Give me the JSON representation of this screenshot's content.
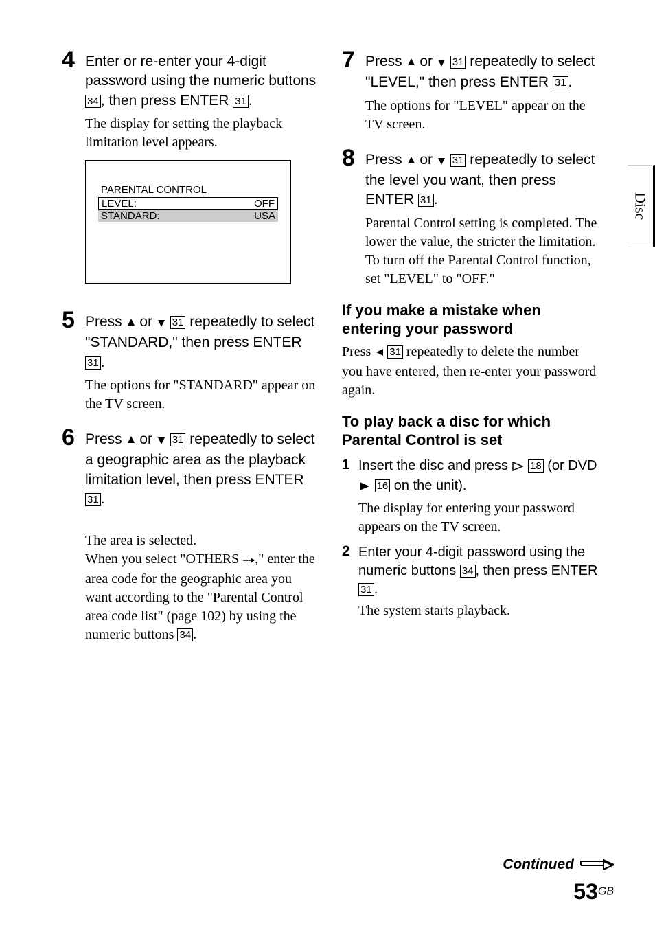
{
  "sideTab": "Disc",
  "leftColumn": {
    "steps": [
      {
        "number": "4",
        "instruction_parts": [
          "Enter or re-enter your 4-digit password using the numeric buttons ",
          "34",
          ", then press ENTER ",
          "31",
          "."
        ],
        "detail": "The display for setting the playback limitation level appears."
      },
      {
        "number": "5",
        "instruction_parts_arrows": {
          "pre": "Press ",
          "post1": " or ",
          "box1": "31",
          "post2": " repeatedly to select \"STANDARD,\" then press ENTER ",
          "box2": "31",
          "end": "."
        },
        "detail": "The options for \"STANDARD\" appear on the TV screen."
      },
      {
        "number": "6",
        "instruction_parts_arrows": {
          "pre": "Press ",
          "post1": " or ",
          "box1": "31",
          "post2": " repeatedly to select a geographic area as the playback limitation level, then press ENTER ",
          "box2": "31",
          "end": "."
        },
        "detail_parts": [
          "The area is selected.\nWhen you select \"OTHERS ",
          ",\" enter the area code for the geographic area you want according to the \"Parental Control area code list\" (page 102) by using the numeric buttons ",
          "34",
          "."
        ]
      }
    ],
    "screen": {
      "title": "PARENTAL CONTROL",
      "rows": [
        {
          "label": "LEVEL:",
          "value": "OFF",
          "selected": true,
          "shaded": false
        },
        {
          "label": "STANDARD:",
          "value": "USA",
          "selected": false,
          "shaded": true
        }
      ]
    }
  },
  "rightColumn": {
    "steps": [
      {
        "number": "7",
        "instruction_parts_arrows": {
          "pre": "Press ",
          "post1": " or ",
          "box1": "31",
          "post2": " repeatedly to select \"LEVEL,\" then press ENTER ",
          "box2": "31",
          "end": "."
        },
        "detail": "The options for \"LEVEL\" appear on the TV screen."
      },
      {
        "number": "8",
        "instruction_parts_arrows": {
          "pre": "Press ",
          "post1": " or ",
          "box1": "31",
          "post2": " repeatedly to select the level you want, then press ENTER ",
          "box2": "31",
          "end": "."
        },
        "detail": "Parental Control setting is completed. The lower the value, the stricter the limitation.\nTo turn off the Parental Control function, set \"LEVEL\" to \"OFF.\""
      }
    ],
    "mistake": {
      "heading": "If you make a mistake when entering your password",
      "text_parts": [
        "Press ",
        "31",
        " repeatedly to delete the number you have entered, then re-enter your password again."
      ]
    },
    "playback": {
      "heading": "To play back a disc for which Parental Control is set",
      "steps": [
        {
          "number": "1",
          "instruction_parts": [
            "Insert the disc and press ",
            "18",
            " (or DVD ",
            "16",
            " on the unit)."
          ],
          "detail": "The display for entering your password appears on the TV screen."
        },
        {
          "number": "2",
          "instruction_parts": [
            "Enter your 4-digit password using the numeric buttons ",
            "34",
            ", then press ENTER ",
            "31",
            "."
          ],
          "detail": "The system starts playback."
        }
      ]
    }
  },
  "footer": {
    "continued": "Continued",
    "pageNumber": "53",
    "pageSuffix": "GB"
  }
}
